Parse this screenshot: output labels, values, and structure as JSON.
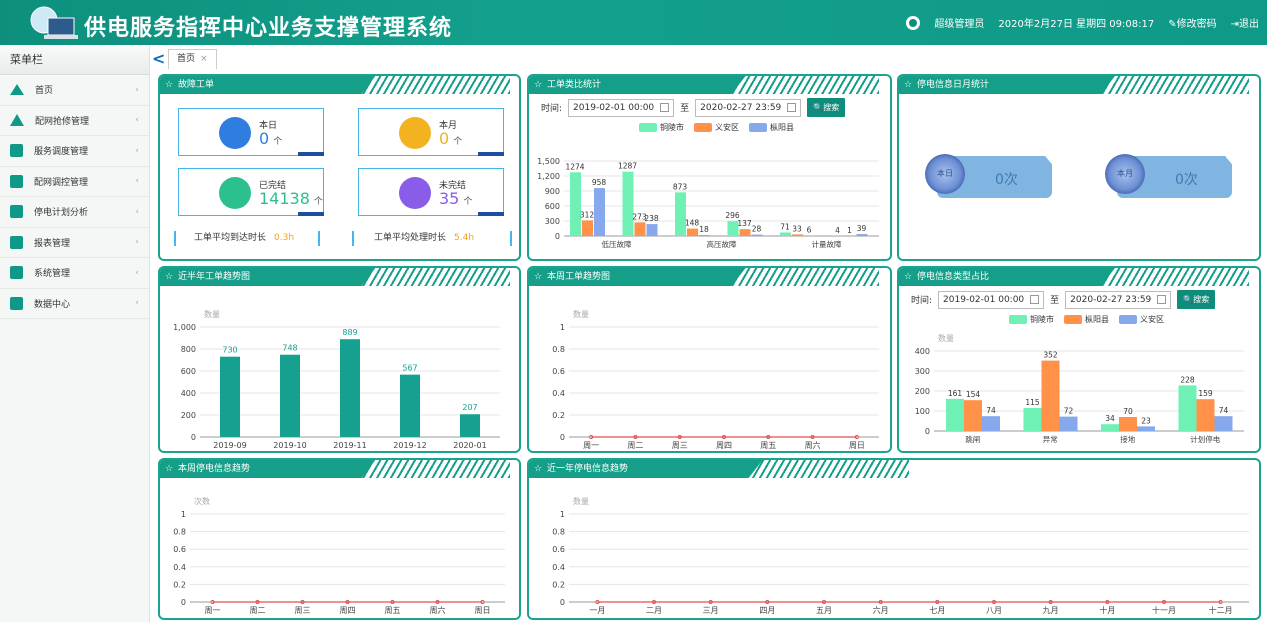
{
  "header": {
    "title": "供电服务指挥中心业务支撑管理系统",
    "user": "超级管理员",
    "datetime": "2020年2月27日 星期四 09:08:17",
    "change_pwd": "修改密码",
    "logout": "退出"
  },
  "sidebar": {
    "title": "菜单栏",
    "items": [
      {
        "label": "首页",
        "icon": "home-icon"
      },
      {
        "label": "配网抢修管理",
        "icon": "warning-icon"
      },
      {
        "label": "服务调度管理",
        "icon": "dispatch-icon"
      },
      {
        "label": "配网调控管理",
        "icon": "control-icon"
      },
      {
        "label": "停电计划分析",
        "icon": "analysis-icon"
      },
      {
        "label": "报表管理",
        "icon": "report-icon"
      },
      {
        "label": "系统管理",
        "icon": "settings-icon"
      },
      {
        "label": "数据中心",
        "icon": "data-icon"
      }
    ]
  },
  "tabs": {
    "back": "<",
    "home": "首页",
    "close": "×"
  },
  "fault": {
    "title": "故障工单",
    "today_label": "本日",
    "today_val": "0",
    "month_label": "本月",
    "month_val": "0",
    "done_label": "已完结",
    "done_val": "14138",
    "undone_label": "未完结",
    "undone_val": "35",
    "unit": "个",
    "avg_arrive_label": "工单平均到达时长",
    "avg_arrive_val": "0.3h",
    "avg_handle_label": "工单平均处理时长",
    "avg_handle_val": "5.4h",
    "colors": {
      "today": "#2f7de0",
      "month": "#f3b320",
      "done": "#2cc08f",
      "undone": "#8a5de8"
    }
  },
  "typestat": {
    "title": "工单类比统计",
    "time_label": "时间:",
    "start": "2019-02-01 00:00",
    "to": "至",
    "end": "2020-02-27 23:59",
    "search": "搜索"
  },
  "outage_daymonth": {
    "title": "停电信息日月统计",
    "day_label": "本日",
    "day_val": "0次",
    "month_label": "本月",
    "month_val": "0次"
  },
  "halfyear": {
    "title": "近半年工单趋势图"
  },
  "week": {
    "title": "本周工单趋势图"
  },
  "outage_type": {
    "title": "停电信息类型占比",
    "time_label": "时间:",
    "start": "2019-02-01 00:00",
    "to": "至",
    "end": "2020-02-27 23:59",
    "search": "搜索"
  },
  "week_outage": {
    "title": "本周停电信息趋势"
  },
  "year_outage": {
    "title": "近一年停电信息趋势"
  },
  "chart_data": [
    {
      "id": "typestat",
      "type": "bar",
      "categories": [
        "低压故障",
        "高压故障",
        "计量故障"
      ],
      "series": [
        {
          "name": "铜陵市",
          "color": "#6ff0b4",
          "values": [
            1274,
            1287,
            873,
            148,
            296,
            137,
            71,
            33,
            4
          ]
        },
        {
          "name": "义安区",
          "color": "#ff9148",
          "values": [
            312,
            273,
            148,
            18,
            137,
            28,
            33,
            6,
            1
          ]
        },
        {
          "name": "枞阳县",
          "color": "#86a8ec",
          "values": [
            958,
            238,
            18,
            28,
            6,
            4,
            1,
            39,
            39
          ]
        }
      ],
      "groups": [
        [
          1274,
          312,
          958
        ],
        [
          1287,
          273,
          238
        ],
        [
          873,
          148,
          18
        ],
        [
          296,
          137,
          28
        ],
        [
          71,
          33,
          6
        ],
        [
          4,
          1,
          39
        ]
      ],
      "yticks": [
        0,
        300,
        600,
        900,
        "1,200",
        "1,500"
      ],
      "ylim": [
        0,
        1500
      ]
    },
    {
      "id": "halfyear",
      "type": "bar",
      "categories": [
        "2019-09",
        "2019-10",
        "2019-11",
        "2019-12",
        "2020-01"
      ],
      "values": [
        730,
        748,
        889,
        567,
        207
      ],
      "ylabel": "数量",
      "yticks": [
        "0",
        "200",
        "400",
        "600",
        "800",
        "1,000"
      ],
      "ylim": [
        0,
        1000
      ],
      "color": "#16a08f"
    },
    {
      "id": "week",
      "type": "line",
      "categories": [
        "周一",
        "周二",
        "周三",
        "周四",
        "周五",
        "周六",
        "周日"
      ],
      "values": [
        0,
        0,
        0,
        0,
        0,
        0,
        0
      ],
      "ylabel": "数量",
      "yticks": [
        "0",
        "0.2",
        "0.4",
        "0.6",
        "0.8",
        "1"
      ],
      "ylim": [
        0,
        1
      ]
    },
    {
      "id": "outage_type",
      "type": "bar",
      "categories": [
        "跳闸",
        "异常",
        "接地",
        "计划停电"
      ],
      "series": [
        {
          "name": "铜陵市",
          "color": "#6ff0b4",
          "values": [
            161,
            115,
            34,
            228
          ]
        },
        {
          "name": "枞阳县",
          "color": "#ff9148",
          "values": [
            154,
            352,
            70,
            159
          ]
        },
        {
          "name": "义安区",
          "color": "#86a8ec",
          "values": [
            74,
            72,
            23,
            74
          ]
        }
      ],
      "ylabel": "数量",
      "yticks": [
        "0",
        "100",
        "200",
        "300",
        "400"
      ],
      "ylim": [
        0,
        400
      ]
    },
    {
      "id": "week_outage",
      "type": "line",
      "categories": [
        "周一",
        "周二",
        "周三",
        "周四",
        "周五",
        "周六",
        "周日"
      ],
      "values": [
        0,
        0,
        0,
        0,
        0,
        0,
        0
      ],
      "ylabel": "次数",
      "yticks": [
        "0",
        "0.2",
        "0.4",
        "0.6",
        "0.8",
        "1"
      ],
      "ylim": [
        0,
        1
      ]
    },
    {
      "id": "year_outage",
      "type": "line",
      "categories": [
        "一月",
        "二月",
        "三月",
        "四月",
        "五月",
        "六月",
        "七月",
        "八月",
        "九月",
        "十月",
        "十一月",
        "十二月"
      ],
      "values": [
        0,
        0,
        0,
        0,
        0,
        0,
        0,
        0,
        0,
        0,
        0,
        0
      ],
      "ylabel": "数量",
      "yticks": [
        "0",
        "0.2",
        "0.4",
        "0.6",
        "0.8",
        "1"
      ],
      "ylim": [
        0,
        1
      ]
    }
  ]
}
